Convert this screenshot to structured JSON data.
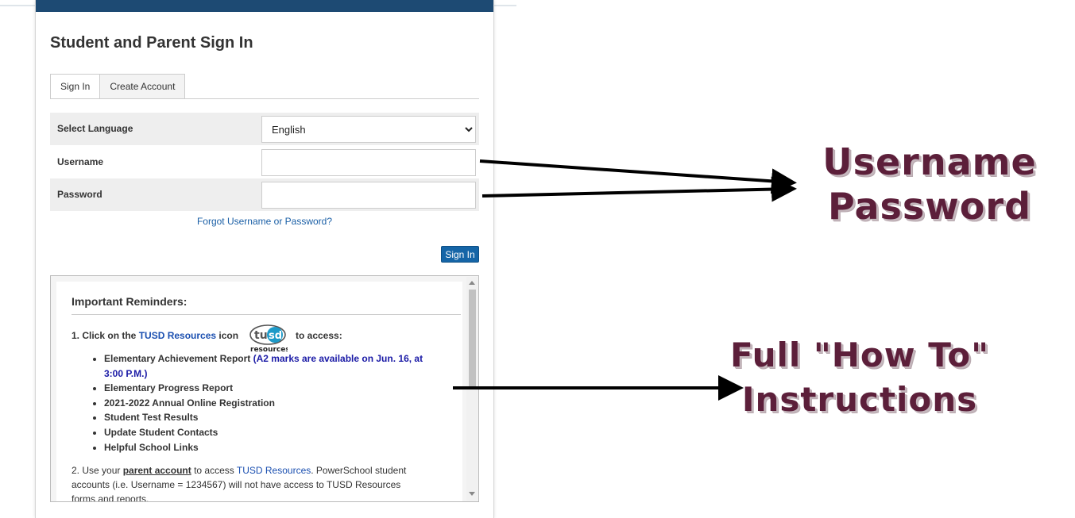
{
  "page": {
    "title": "Student and Parent Sign In",
    "tabs": [
      {
        "label": "Sign In",
        "active": true
      },
      {
        "label": "Create Account",
        "active": false
      }
    ]
  },
  "form": {
    "language_label": "Select Language",
    "language_value": "English",
    "username_label": "Username",
    "username_value": "",
    "password_label": "Password",
    "password_value": "",
    "forgot_link": "Forgot Username or Password?",
    "signin_button": "Sign In"
  },
  "reminders": {
    "title": "Important Reminders:",
    "step1_prefix": "1. Click on the",
    "step1_link": "TUSD Resources",
    "step1_mid": "icon",
    "step1_suffix": "to access:",
    "logo_text_top": "tu",
    "logo_text_sd": "sd",
    "logo_text_bottom": "resources",
    "items": [
      {
        "text": "Elementary Achievement Report",
        "note": "(A2 marks are available on Jun. 16, at 3:00 P.M.)"
      },
      {
        "text": "Elementary Progress Report",
        "note": ""
      },
      {
        "text": "2021-2022 Annual Online Registration",
        "note": ""
      },
      {
        "text": "Student Test Results",
        "note": ""
      },
      {
        "text": "Update Student Contacts",
        "note": ""
      },
      {
        "text": "Helpful School Links",
        "note": ""
      }
    ],
    "step2_prefix": "2. Use your",
    "step2_bold": "parent account",
    "step2_mid": "to access",
    "step2_link": "TUSD Resources",
    "step2_rest": ". PowerSchool student accounts (i.e. Username = 1234567) will not have access to TUSD Resources forms and reports."
  },
  "annotations": {
    "label1_line1": "Username",
    "label1_line2": "Password",
    "label2_line1": "Full \"How To\"",
    "label2_line2": "Instructions"
  },
  "colors": {
    "header_bar": "#1d4a73",
    "button": "#1565a7",
    "link": "#1a4fb0",
    "annotation": "#5c1f3a"
  }
}
